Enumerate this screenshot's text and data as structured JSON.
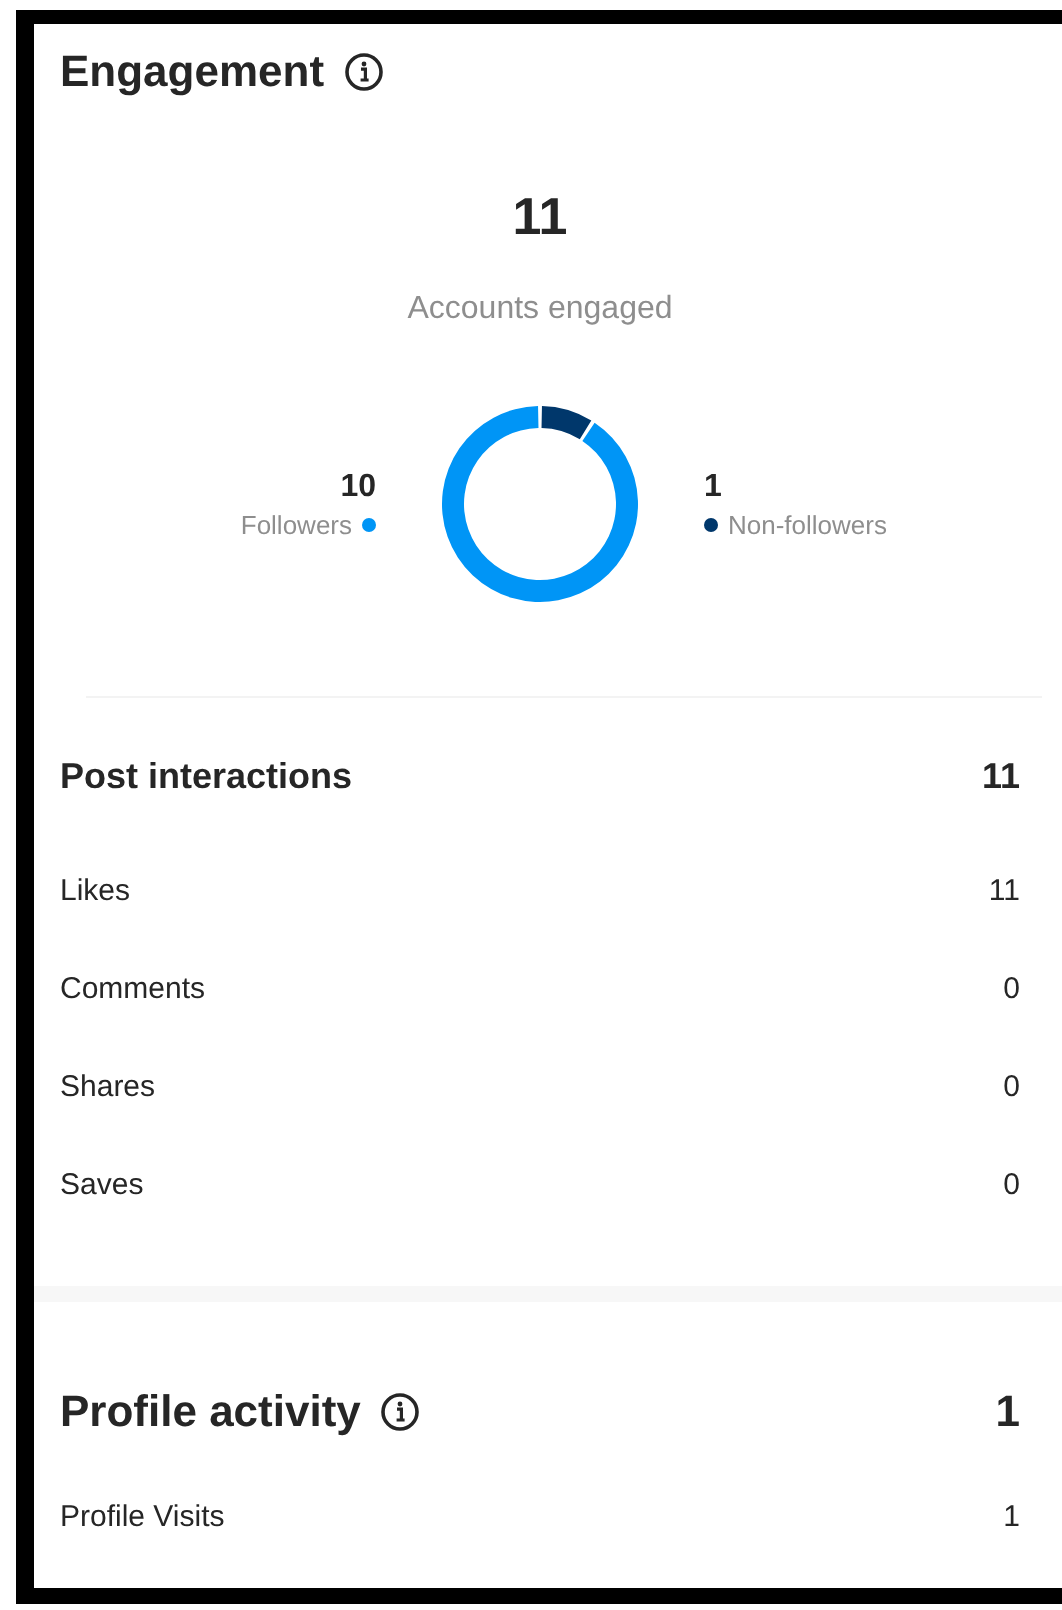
{
  "engagement": {
    "title": "Engagement",
    "total": "11",
    "total_label": "Accounts engaged",
    "legend": [
      {
        "value": "10",
        "label": "Followers",
        "color": "#0095f6"
      },
      {
        "value": "1",
        "label": "Non-followers",
        "color": "#00376b"
      }
    ]
  },
  "post_interactions": {
    "title": "Post interactions",
    "total": "11",
    "rows": [
      {
        "label": "Likes",
        "value": "11"
      },
      {
        "label": "Comments",
        "value": "0"
      },
      {
        "label": "Shares",
        "value": "0"
      },
      {
        "label": "Saves",
        "value": "0"
      }
    ]
  },
  "profile_activity": {
    "title": "Profile activity",
    "total": "1",
    "rows": [
      {
        "label": "Profile Visits",
        "value": "1"
      }
    ]
  }
}
